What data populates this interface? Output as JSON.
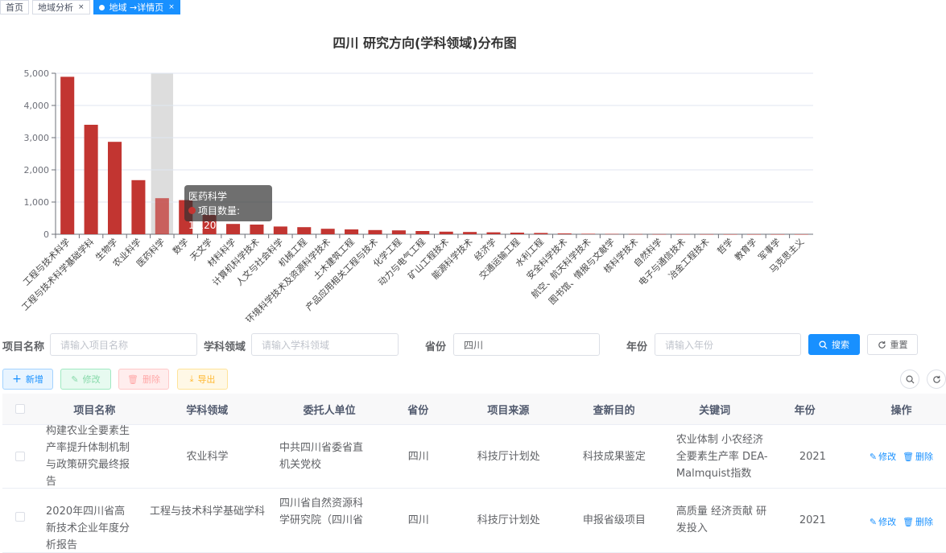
{
  "tabs": [
    {
      "label": "首页",
      "closable": false,
      "active": false
    },
    {
      "label": "地域分析",
      "closable": true,
      "active": false
    },
    {
      "label": "地域 →详情页",
      "closable": true,
      "active": true
    }
  ],
  "tab_close_glyph": "×",
  "chart_data": {
    "type": "bar",
    "title": "四川 研究方向(学科领域)分布图",
    "categories": [
      "工程与技术科学",
      "工程与技术科学基础学科",
      "生物学",
      "农业科学",
      "医药科学",
      "数学",
      "天文学",
      "材料科学",
      "计算机科学技术",
      "人文与社会科学",
      "机械工程",
      "环境科学技术及资源科学技术",
      "土木建筑工程",
      "产品应用相关工程与技术",
      "化学工程",
      "动力与电气工程",
      "矿山工程技术",
      "能源科学技术",
      "经济学",
      "交通运输工程",
      "水利工程",
      "安全科学技术",
      "航空、航天科学技术",
      "图书馆、情报与文献学",
      "核科学技术",
      "自然科学",
      "电子与通信技术",
      "冶金工程技术",
      "哲学",
      "教育学",
      "军事学",
      "马克思主义"
    ],
    "series": [
      {
        "name": "项目数量",
        "values": [
          4890,
          3400,
          2870,
          1680,
          1120,
          1060,
          600,
          320,
          300,
          240,
          220,
          170,
          150,
          130,
          120,
          100,
          80,
          70,
          60,
          50,
          40,
          25,
          15,
          10,
          5,
          3,
          2,
          2,
          1,
          1,
          1,
          1
        ]
      }
    ],
    "ylim": [
      0,
      5000
    ],
    "yticks": [
      "0",
      "1,000",
      "2,000",
      "3,000",
      "4,000",
      "5,000"
    ],
    "grid": true,
    "bar_color": "#c23531",
    "highlight_index": 4,
    "highlight_color": "#dddddd"
  },
  "tooltip": {
    "title": "医药科学",
    "series": "项目数量",
    "value": "1,120"
  },
  "search": {
    "name_label": "项目名称",
    "name_placeholder": "请输入项目名称",
    "field_label": "学科领域",
    "field_placeholder": "请输入学科领域",
    "province_label": "省份",
    "province_value": "四川",
    "year_label": "年份",
    "year_placeholder": "请输入年份",
    "search_button": "搜索",
    "reset_button": "重置"
  },
  "toolbar": {
    "add": "新增",
    "edit": "修改",
    "delete": "删除",
    "export": "导出"
  },
  "table": {
    "headers": [
      "项目名称",
      "学科领域",
      "委托人单位",
      "省份",
      "项目来源",
      "查新目的",
      "关键词",
      "年份",
      "操作"
    ],
    "rows": [
      {
        "name": "构建农业全要素生产率提升体制机制与政策研究最终报告",
        "field": "农业科学",
        "client": "中共四川省委省直机关党校",
        "province": "四川",
        "source": "科技厅计划处",
        "purpose": "科技成果鉴定",
        "keywords": "农业体制 小农经济 全要素生产率 DEA-Malmquist指数",
        "year": "2021"
      },
      {
        "name": "2020年四川省高新技术企业年度分析报告",
        "field": "工程与技术科学基础学科",
        "client": "四川省自然资源科学研究院（四川省",
        "province": "四川",
        "source": "科技厅计划处",
        "purpose": "申报省级项目",
        "keywords": "高质量 经济贡献 研发投入",
        "year": "2021"
      }
    ],
    "row_actions": {
      "edit": "修改",
      "delete": "删除"
    }
  },
  "colors": {
    "primary": "#1890ff",
    "bar": "#c23531"
  }
}
